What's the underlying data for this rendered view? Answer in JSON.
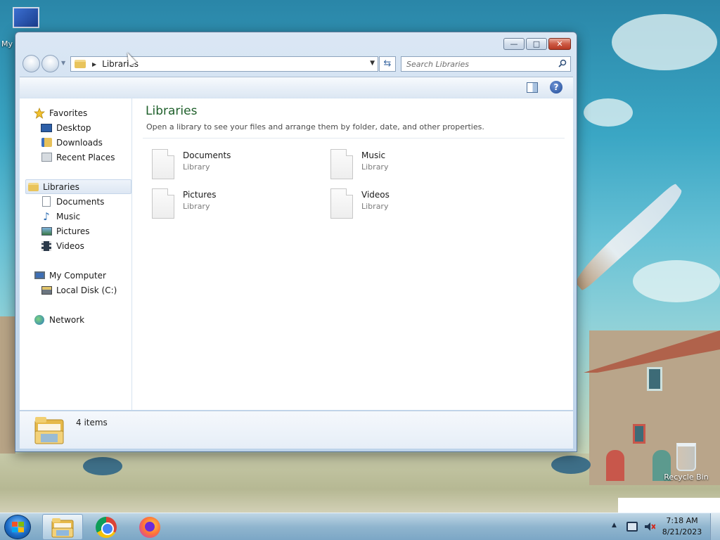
{
  "desktop": {
    "icons": [
      {
        "label": "My",
        "icon": "computer-icon"
      },
      {
        "label": "Recycle Bin",
        "icon": "recycle-bin-icon"
      }
    ]
  },
  "window": {
    "address": {
      "folder_icon": "libraries-icon",
      "path": "Libraries"
    },
    "search": {
      "placeholder": "Search Libraries"
    },
    "caption_buttons": {
      "minimize": "—",
      "maximize": "□",
      "close": "✕"
    },
    "toolbar": {
      "help": "?"
    },
    "nav_pane": {
      "favorites": {
        "label": "Favorites",
        "items": [
          {
            "label": "Desktop"
          },
          {
            "label": "Downloads"
          },
          {
            "label": "Recent Places"
          }
        ]
      },
      "libraries": {
        "label": "Libraries",
        "items": [
          {
            "label": "Documents"
          },
          {
            "label": "Music"
          },
          {
            "label": "Pictures"
          },
          {
            "label": "Videos"
          }
        ]
      },
      "computer": {
        "label": "My Computer",
        "items": [
          {
            "label": "Local Disk (C:)"
          }
        ]
      },
      "network": {
        "label": "Network"
      }
    },
    "content": {
      "title": "Libraries",
      "subtitle": "Open a library to see your files and arrange them by folder, date, and other properties.",
      "items": [
        {
          "name": "Documents",
          "type": "Library"
        },
        {
          "name": "Music",
          "type": "Library"
        },
        {
          "name": "Pictures",
          "type": "Library"
        },
        {
          "name": "Videos",
          "type": "Library"
        }
      ]
    },
    "details": {
      "count": "4 items"
    }
  },
  "taskbar": {
    "clock": {
      "time": "7:18 AM",
      "date": "8/21/2023"
    },
    "apps": [
      {
        "name": "file-explorer-icon",
        "active": true
      },
      {
        "name": "chrome-icon",
        "active": false
      },
      {
        "name": "firefox-icon",
        "active": false
      }
    ]
  },
  "colors": {
    "content_title": "#1e5f2a",
    "close_button": "#cd5a44",
    "taskbar": "#8cb4d2"
  }
}
